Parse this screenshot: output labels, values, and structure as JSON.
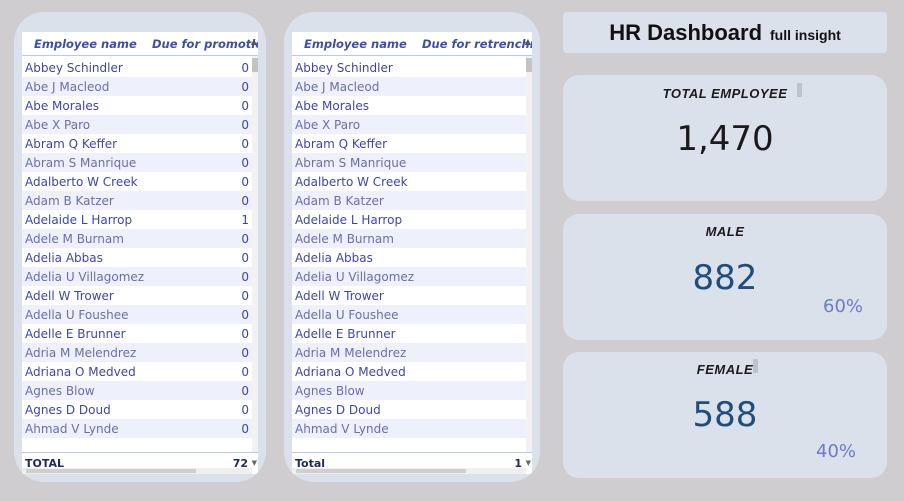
{
  "tables": [
    {
      "headers": [
        "Employee name",
        "Due for promotion"
      ],
      "rows": [
        {
          "name": "Abbey Schindler",
          "value": "0"
        },
        {
          "name": "Abe J Macleod",
          "value": "0"
        },
        {
          "name": "Abe Morales",
          "value": "0"
        },
        {
          "name": "Abe X Paro",
          "value": "0"
        },
        {
          "name": "Abram Q Keffer",
          "value": "0"
        },
        {
          "name": "Abram S Manrique",
          "value": "0"
        },
        {
          "name": "Adalberto W Creek",
          "value": "0"
        },
        {
          "name": "Adam B Katzer",
          "value": "0"
        },
        {
          "name": "Adelaide L Harrop",
          "value": "1"
        },
        {
          "name": "Adele M Burnam",
          "value": "0"
        },
        {
          "name": "Adelia Abbas",
          "value": "0"
        },
        {
          "name": "Adelia U Villagomez",
          "value": "0"
        },
        {
          "name": "Adell W Trower",
          "value": "0"
        },
        {
          "name": "Adella U Foushee",
          "value": "0"
        },
        {
          "name": "Adelle E Brunner",
          "value": "0"
        },
        {
          "name": "Adria M Melendrez",
          "value": "0"
        },
        {
          "name": "Adriana O Medved",
          "value": "0"
        },
        {
          "name": "Agnes Blow",
          "value": "0"
        },
        {
          "name": "Agnes D Doud",
          "value": "0"
        },
        {
          "name": "Ahmad V Lynde",
          "value": "0"
        }
      ],
      "total_label": "TOTAL",
      "total_value": "72"
    },
    {
      "headers": [
        "Employee name",
        "Due for retrenchme"
      ],
      "rows": [
        {
          "name": "Abbey Schindler",
          "value": ""
        },
        {
          "name": "Abe J Macleod",
          "value": ""
        },
        {
          "name": "Abe Morales",
          "value": ""
        },
        {
          "name": "Abe X Paro",
          "value": ""
        },
        {
          "name": "Abram Q Keffer",
          "value": ""
        },
        {
          "name": "Abram S Manrique",
          "value": ""
        },
        {
          "name": "Adalberto W Creek",
          "value": ""
        },
        {
          "name": "Adam B Katzer",
          "value": ""
        },
        {
          "name": "Adelaide L Harrop",
          "value": ""
        },
        {
          "name": "Adele M Burnam",
          "value": ""
        },
        {
          "name": "Adelia Abbas",
          "value": ""
        },
        {
          "name": "Adelia U Villagomez",
          "value": ""
        },
        {
          "name": "Adell W Trower",
          "value": ""
        },
        {
          "name": "Adella U Foushee",
          "value": ""
        },
        {
          "name": "Adelle E Brunner",
          "value": ""
        },
        {
          "name": "Adria M Melendrez",
          "value": ""
        },
        {
          "name": "Adriana O Medved",
          "value": ""
        },
        {
          "name": "Agnes Blow",
          "value": ""
        },
        {
          "name": "Agnes D Doud",
          "value": ""
        },
        {
          "name": "Ahmad V Lynde",
          "value": ""
        }
      ],
      "total_label": "Total",
      "total_value": "1"
    }
  ],
  "dashboard": {
    "title": "HR Dashboard",
    "subtitle": "full insight"
  },
  "kpis": {
    "total": {
      "label": "TOTAL EMPLOYEE",
      "value": "1,470"
    },
    "male": {
      "label": "MALE",
      "value": "882",
      "pct": "60%"
    },
    "female": {
      "label": "FEMALE",
      "value": "588",
      "pct": "40%"
    }
  },
  "colors": {
    "background": "#cfcdcf",
    "panel": "#dbe1ea",
    "table_text": "#3d46a8",
    "header_text": "#3d4fa4",
    "kpi_total": "#1a1a1a",
    "kpi_gender": "#1f4e7e",
    "pct_text": "#6b7cc7"
  },
  "icons": [
    "sort-caret-icon",
    "scroll-caret-icon"
  ]
}
